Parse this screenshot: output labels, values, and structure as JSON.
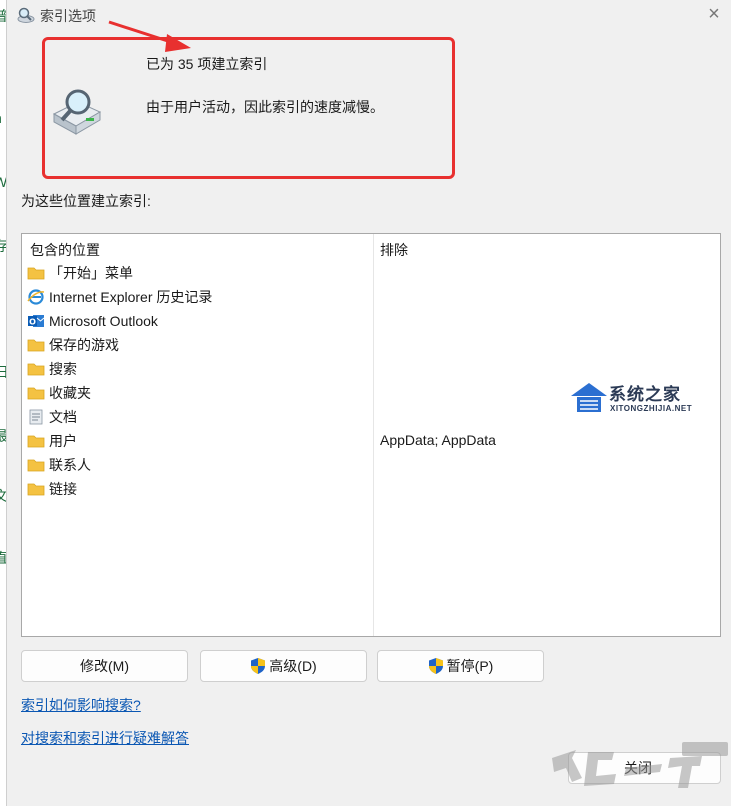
{
  "window": {
    "title": "索引选项",
    "close_glyph": "×"
  },
  "status": {
    "indexed_line": "已为 35 项建立索引",
    "speed_line": "由于用户活动，因此索引的速度减慢。"
  },
  "locations": {
    "label": "为这些位置建立索引:",
    "included_header": "包含的位置",
    "excluded_header": "排除",
    "items": [
      {
        "label": "「开始」菜单",
        "icon": "folder-icon"
      },
      {
        "label": "Internet Explorer 历史记录",
        "icon": "internet-explorer-icon"
      },
      {
        "label": "Microsoft Outlook",
        "icon": "outlook-icon"
      },
      {
        "label": "保存的游戏",
        "icon": "folder-icon"
      },
      {
        "label": "搜索",
        "icon": "folder-icon"
      },
      {
        "label": "收藏夹",
        "icon": "folder-icon"
      },
      {
        "label": "文档",
        "icon": "document-icon"
      },
      {
        "label": "用户",
        "icon": "folder-icon"
      },
      {
        "label": "联系人",
        "icon": "folder-icon"
      },
      {
        "label": "链接",
        "icon": "folder-icon"
      }
    ],
    "excluded_value": "AppData; AppData"
  },
  "buttons": {
    "modify": "修改(M)",
    "advanced": "高级(D)",
    "pause": "暂停(P)",
    "close": "关闭"
  },
  "links": {
    "how_affects": "索引如何影响搜索?",
    "troubleshoot": "对搜索和索引进行疑难解答"
  },
  "watermark": {
    "title": "系统之家",
    "subtitle": "XITONGZHIJIA.NET"
  },
  "colors": {
    "highlight_box": "#e8302f",
    "link": "#0b57b3",
    "folder": "#f4c242",
    "shield_blue": "#1e63c7",
    "shield_yellow": "#f6c21a"
  }
}
